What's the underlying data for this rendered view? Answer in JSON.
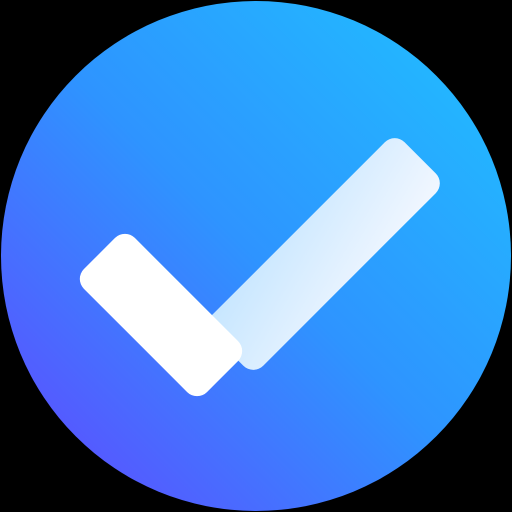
{
  "background": "#000000",
  "icon": {
    "name": "checkmark-icon",
    "circle_gradient": {
      "top_right": "#1FC2FF",
      "center": "#2E94FF",
      "bottom_left": "#6344FF"
    },
    "check_short_stroke_color": "#FFFFFF",
    "check_long_stroke_colors": [
      "#F2F7FF",
      "#C6E6FF"
    ]
  }
}
